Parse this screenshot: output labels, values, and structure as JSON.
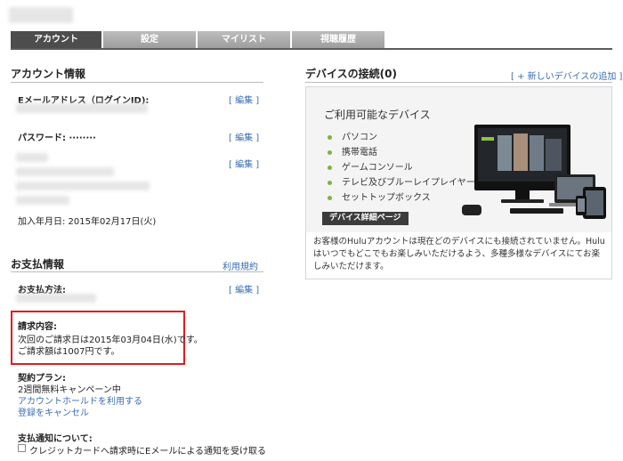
{
  "tabs": [
    {
      "label": "アカウント",
      "active": true
    },
    {
      "label": "設定",
      "active": false
    },
    {
      "label": "マイリスト",
      "active": false
    },
    {
      "label": "視聴履歴",
      "active": false
    }
  ],
  "account": {
    "title": "アカウント情報",
    "email_label": "Eメールアドレス（ログインID):",
    "password_label": "パスワード: ········",
    "edit_label": "[ 編集 ]",
    "join_date": "加入年月日: 2015年02月17日(火)"
  },
  "payment": {
    "title": "お支払情報",
    "terms_link": "利用規約",
    "method_label": "お支払方法:",
    "edit_label": "[ 編集 ]",
    "billing_label": "請求内容:",
    "billing_line1": "次回のご請求日は2015年03月04日(水)です。",
    "billing_line2": "ご請求額は1007円です。",
    "plan_label": "契約プラン:",
    "plan_value": "2週間無料キャンペーン中",
    "hold_link": "アカウントホールドを利用する",
    "cancel_link": "登録をキャンセル",
    "notice_label": "支払通知について:",
    "notice_checkbox": "クレジットカードへ請求時にEメールによる通知を受け取る"
  },
  "devices": {
    "title": "デバイスの接続(0)",
    "add_link": "[ + 新しいデバイスの追加 ]",
    "available_title": "ご利用可能なデバイス",
    "items": [
      "パソコン",
      "携帯電話",
      "ゲームコンソール",
      "テレビ及びブルーレイプレイヤー",
      "セットトップボックス"
    ],
    "detail_button": "デバイス詳細ページ",
    "description": "お客様のHuluアカウントは現在どのデバイスにも接続されていません。Huluはいつでもどこでもお楽しみいただけるよう、多種多様なデバイスにてお楽しみいただけます。",
    "bullet_color": "#7cb342"
  },
  "colors": {
    "link": "#3a6db3",
    "highlight": "#e31b1b",
    "tab_active": "#4d4d4d"
  }
}
